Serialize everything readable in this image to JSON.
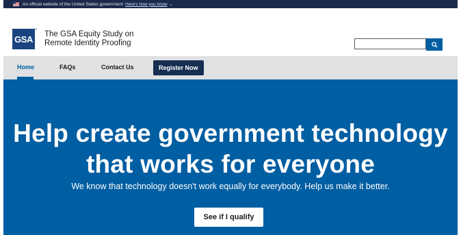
{
  "banner": {
    "text": "An official website of the United States government",
    "link": "Here's how you know",
    "chevron": "⌄"
  },
  "header": {
    "logo_text": "GSA",
    "logo_tm": "®",
    "title_line1": "The GSA Equity Study on",
    "title_line2": "Remote Identity Proofing"
  },
  "search": {
    "value": "",
    "placeholder": "",
    "icon": "search-icon"
  },
  "nav": {
    "items": [
      {
        "label": "Home",
        "active": true
      },
      {
        "label": "FAQs",
        "active": false
      },
      {
        "label": "Contact Us",
        "active": false
      }
    ],
    "register_label": "Register Now"
  },
  "hero": {
    "headline_line1": "Help create government technology",
    "headline_line2": "that works for everyone",
    "subhead": "We know that technology doesn't work equally for everybody. Help us make it better.",
    "cta_label": "See if I qualify"
  },
  "colors": {
    "banner_bg": "#1b2a4a",
    "primary_blue": "#005ea2",
    "dark_navy": "#162e51",
    "logo_blue": "#1a4480",
    "nav_bg": "#dfe1e2"
  }
}
